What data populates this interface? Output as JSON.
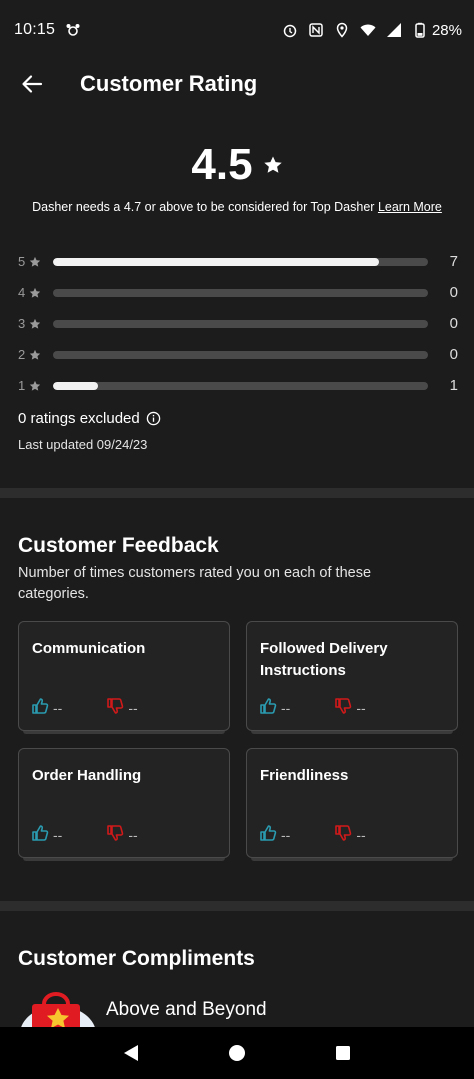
{
  "status_bar": {
    "time": "10:15",
    "battery": "28%",
    "icons": [
      "alarm-icon",
      "nfc-icon",
      "location-icon",
      "wifi-icon",
      "signal-icon",
      "battery-icon"
    ]
  },
  "header": {
    "title": "Customer Rating"
  },
  "rating": {
    "value": "4.5",
    "note": "Dasher needs a 4.7 or above to be considered for Top Dasher ",
    "learn_more": "Learn More",
    "distribution": [
      {
        "stars": "5",
        "count": "7",
        "fraction": 0.87
      },
      {
        "stars": "4",
        "count": "0",
        "fraction": 0
      },
      {
        "stars": "3",
        "count": "0",
        "fraction": 0
      },
      {
        "stars": "2",
        "count": "0",
        "fraction": 0
      },
      {
        "stars": "1",
        "count": "1",
        "fraction": 0.12
      }
    ],
    "excluded": "0 ratings excluded",
    "updated": "Last updated 09/24/23"
  },
  "feedback": {
    "title": "Customer Feedback",
    "subtitle": "Number of times customers rated you on each of these categories.",
    "cards": [
      {
        "title": "Communication",
        "up": "--",
        "down": "--"
      },
      {
        "title": "Followed Delivery Instructions",
        "up": "--",
        "down": "--"
      },
      {
        "title": "Order Handling",
        "up": "--",
        "down": "--"
      },
      {
        "title": "Friendliness",
        "up": "--",
        "down": "--"
      }
    ]
  },
  "compliments": {
    "title": "Customer Compliments",
    "items": [
      {
        "label": "Above and Beyond"
      }
    ]
  },
  "colors": {
    "background": "#1c1c1c",
    "thumb_up": "#2a9bb0",
    "thumb_down": "#d1191a",
    "bar_fill": "#f2f2f2",
    "bar_track": "#4a4a4a"
  }
}
